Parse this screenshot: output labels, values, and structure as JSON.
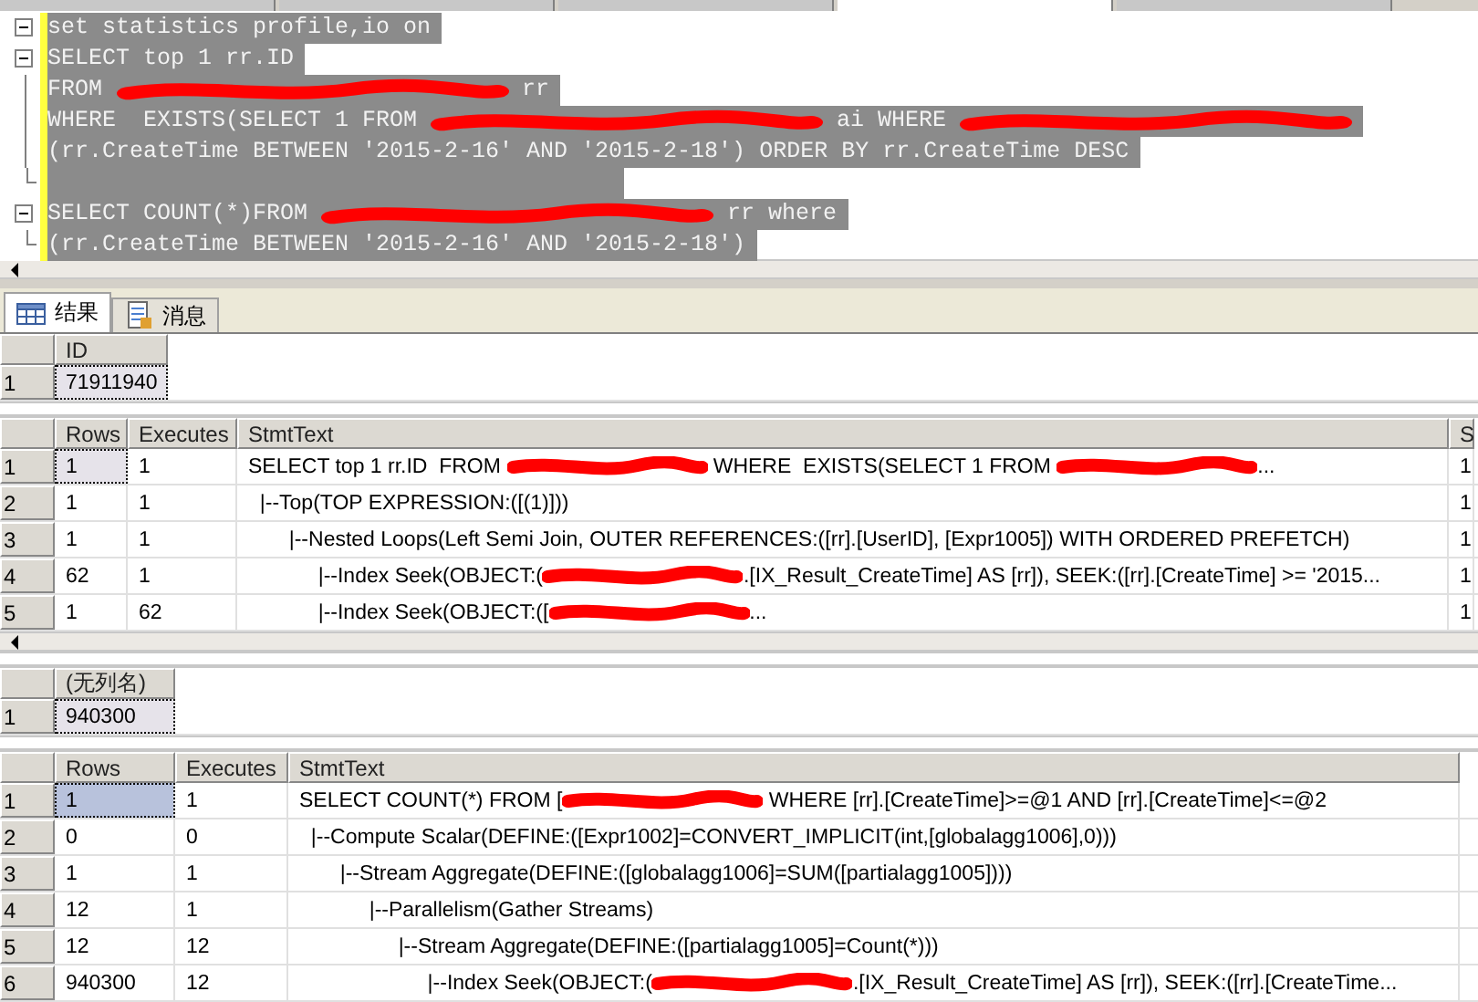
{
  "document_tabs": [
    {
      "selected": false
    },
    {
      "selected": false
    },
    {
      "selected": false
    },
    {
      "selected": true
    },
    {
      "selected": false
    }
  ],
  "editor": {
    "lines": [
      {
        "kind": "start",
        "segments": [
          {
            "kind": "text",
            "text": "set statistics profile,io on"
          }
        ]
      },
      {
        "kind": "start",
        "segments": [
          {
            "kind": "text",
            "text": "SELECT top 1 rr.ID"
          }
        ]
      },
      {
        "kind": "inner",
        "segments": [
          {
            "kind": "text",
            "text": "FROM "
          },
          {
            "kind": "redaction"
          },
          {
            "kind": "text",
            "text": " rr"
          }
        ]
      },
      {
        "kind": "inner",
        "segments": [
          {
            "kind": "text",
            "text": "WHERE  EXISTS(SELECT 1 FROM "
          },
          {
            "kind": "redaction"
          },
          {
            "kind": "text",
            "text": " ai WHERE "
          },
          {
            "kind": "redaction"
          }
        ]
      },
      {
        "kind": "inner",
        "segments": [
          {
            "kind": "text",
            "text": "(rr.CreateTime BETWEEN '2015-2-16' AND '2015-2-18') ORDER BY rr.CreateTime DESC"
          }
        ]
      },
      {
        "kind": "end"
      },
      {
        "kind": "start",
        "segments": [
          {
            "kind": "text",
            "text": "SELECT COUNT(*)FROM "
          },
          {
            "kind": "redaction"
          },
          {
            "kind": "text",
            "text": " rr where"
          }
        ]
      },
      {
        "kind": "end",
        "segments": [
          {
            "kind": "text",
            "text": "(rr.CreateTime BETWEEN '2015-2-16' AND '2015-2-18')"
          }
        ]
      }
    ]
  },
  "result_tabs": [
    {
      "kind": "grid",
      "label": "结果",
      "selected": true
    },
    {
      "kind": "message",
      "label": "消息",
      "selected": false
    }
  ],
  "grids": [
    {
      "active": false,
      "columns": [
        {
          "label": "ID"
        }
      ],
      "rows": [
        {
          "number": "1",
          "cells": [
            {
              "text": "71911940",
              "focused": true
            }
          ]
        }
      ]
    },
    {
      "active": false,
      "columns": [
        {
          "label": "Rows"
        },
        {
          "label": "Executes"
        },
        {
          "label": "StmtText"
        },
        {
          "label": "S"
        }
      ],
      "rows": [
        {
          "number": "1",
          "cells": [
            {
              "text": "1",
              "focused": true
            },
            {
              "text": "1",
              "focused": false
            },
            {
              "segments": [
                {
                  "kind": "text",
                  "text": "SELECT top 1 rr.ID  FROM "
                },
                {
                  "kind": "redaction"
                },
                {
                  "kind": "text",
                  "text": " WHERE  EXISTS(SELECT 1 FROM "
                },
                {
                  "kind": "redaction"
                },
                {
                  "kind": "text",
                  "text": "..."
                }
              ],
              "focused": false
            },
            {
              "text": "1",
              "focused": false
            }
          ]
        },
        {
          "number": "2",
          "cells": [
            {
              "text": "1",
              "focused": false
            },
            {
              "text": "1",
              "focused": false
            },
            {
              "segments": [
                {
                  "kind": "text",
                  "text": "  |--Top(TOP EXPRESSION:([(1)]))"
                }
              ],
              "focused": false
            },
            {
              "text": "1",
              "focused": false
            }
          ]
        },
        {
          "number": "3",
          "cells": [
            {
              "text": "1",
              "focused": false
            },
            {
              "text": "1",
              "focused": false
            },
            {
              "segments": [
                {
                  "kind": "text",
                  "text": "       |--Nested Loops(Left Semi Join, OUTER REFERENCES:([rr].[UserID], [Expr1005]) WITH ORDERED PREFETCH)"
                }
              ],
              "focused": false
            },
            {
              "text": "1",
              "focused": false
            }
          ]
        },
        {
          "number": "4",
          "cells": [
            {
              "text": "62",
              "focused": false
            },
            {
              "text": "1",
              "focused": false
            },
            {
              "segments": [
                {
                  "kind": "text",
                  "text": "            |--Index Seek(OBJECT:("
                },
                {
                  "kind": "redaction"
                },
                {
                  "kind": "text",
                  "text": ".[IX_Result_CreateTime] AS [rr]), SEEK:([rr].[CreateTime] >= '2015..."
                }
              ],
              "focused": false
            },
            {
              "text": "1",
              "focused": false
            }
          ]
        },
        {
          "number": "5",
          "cells": [
            {
              "text": "1",
              "focused": false
            },
            {
              "text": "62",
              "focused": false
            },
            {
              "segments": [
                {
                  "kind": "text",
                  "text": "            |--Index Seek(OBJECT:(["
                },
                {
                  "kind": "redaction"
                },
                {
                  "kind": "text",
                  "text": "..."
                }
              ],
              "focused": false
            },
            {
              "text": "1",
              "focused": false
            }
          ]
        }
      ]
    },
    {
      "active": false,
      "columns": [
        {
          "label": "(无列名)"
        }
      ],
      "rows": [
        {
          "number": "1",
          "cells": [
            {
              "text": "940300",
              "focused": true
            }
          ]
        }
      ]
    },
    {
      "active": true,
      "columns": [
        {
          "label": "Rows"
        },
        {
          "label": "Executes"
        },
        {
          "label": "StmtText"
        }
      ],
      "rows": [
        {
          "number": "1",
          "cells": [
            {
              "text": "1",
              "focused": true
            },
            {
              "text": "1",
              "focused": false
            },
            {
              "segments": [
                {
                  "kind": "text",
                  "text": "SELECT COUNT(*) FROM ["
                },
                {
                  "kind": "redaction"
                },
                {
                  "kind": "text",
                  "text": " WHERE [rr].[CreateTime]>=@1 AND [rr].[CreateTime]<=@2"
                }
              ],
              "focused": false
            }
          ]
        },
        {
          "number": "2",
          "cells": [
            {
              "text": "0",
              "focused": false
            },
            {
              "text": "0",
              "focused": false
            },
            {
              "segments": [
                {
                  "kind": "text",
                  "text": "  |--Compute Scalar(DEFINE:([Expr1002]=CONVERT_IMPLICIT(int,[globalagg1006],0)))"
                }
              ],
              "focused": false
            }
          ]
        },
        {
          "number": "3",
          "cells": [
            {
              "text": "1",
              "focused": false
            },
            {
              "text": "1",
              "focused": false
            },
            {
              "segments": [
                {
                  "kind": "text",
                  "text": "       |--Stream Aggregate(DEFINE:([globalagg1006]=SUM([partialagg1005])))"
                }
              ],
              "focused": false
            }
          ]
        },
        {
          "number": "4",
          "cells": [
            {
              "text": "12",
              "focused": false
            },
            {
              "text": "1",
              "focused": false
            },
            {
              "segments": [
                {
                  "kind": "text",
                  "text": "            |--Parallelism(Gather Streams)"
                }
              ],
              "focused": false
            }
          ]
        },
        {
          "number": "5",
          "cells": [
            {
              "text": "12",
              "focused": false
            },
            {
              "text": "12",
              "focused": false
            },
            {
              "segments": [
                {
                  "kind": "text",
                  "text": "                 |--Stream Aggregate(DEFINE:([partialagg1005]=Count(*)))"
                }
              ],
              "focused": false
            }
          ]
        },
        {
          "number": "6",
          "cells": [
            {
              "text": "940300",
              "focused": false
            },
            {
              "text": "12",
              "focused": false
            },
            {
              "segments": [
                {
                  "kind": "text",
                  "text": "                      |--Index Seek(OBJECT:("
                },
                {
                  "kind": "redaction"
                },
                {
                  "kind": "text",
                  "text": ".[IX_Result_CreateTime] AS [rr]), SEEK:([rr].[CreateTime..."
                }
              ],
              "focused": false
            }
          ]
        }
      ]
    }
  ]
}
